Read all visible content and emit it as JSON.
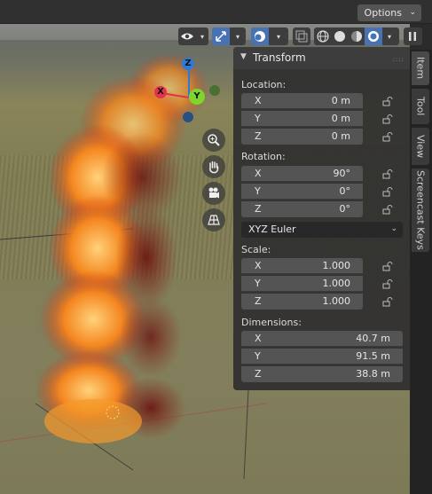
{
  "header": {
    "options_label": "Options"
  },
  "toolbar": {
    "icons": [
      "visibility-icon",
      "gizmo-icon",
      "overlay-icon",
      "xray-icon",
      "wireframe-shading-icon",
      "solid-shading-icon",
      "material-shading-icon",
      "rendered-shading-icon",
      "pause-icon"
    ]
  },
  "gizmo": {
    "z": "Z",
    "y": "Y",
    "x": "X"
  },
  "panel": {
    "title": "Transform",
    "location": {
      "label": "Location:",
      "rows": [
        {
          "axis": "X",
          "value": "0 m"
        },
        {
          "axis": "Y",
          "value": "0 m"
        },
        {
          "axis": "Z",
          "value": "0 m"
        }
      ]
    },
    "rotation": {
      "label": "Rotation:",
      "rows": [
        {
          "axis": "X",
          "value": "90°"
        },
        {
          "axis": "Y",
          "value": "0°"
        },
        {
          "axis": "Z",
          "value": "0°"
        }
      ],
      "mode": "XYZ Euler"
    },
    "scale": {
      "label": "Scale:",
      "rows": [
        {
          "axis": "X",
          "value": "1.000"
        },
        {
          "axis": "Y",
          "value": "1.000"
        },
        {
          "axis": "Z",
          "value": "1.000"
        }
      ]
    },
    "dimensions": {
      "label": "Dimensions:",
      "rows": [
        {
          "axis": "X",
          "value": "40.7 m"
        },
        {
          "axis": "Y",
          "value": "91.5 m"
        },
        {
          "axis": "Z",
          "value": "38.8 m"
        }
      ]
    }
  },
  "tabs": [
    "Item",
    "Tool",
    "View",
    "Screencast Keys"
  ],
  "colors": {
    "x_axis": "#e0344e",
    "y_axis": "#7fd42e",
    "z_axis": "#2f7ad8",
    "field_bg": "#545454",
    "panel_bg": "#303030",
    "fire": "#f07a1a"
  }
}
